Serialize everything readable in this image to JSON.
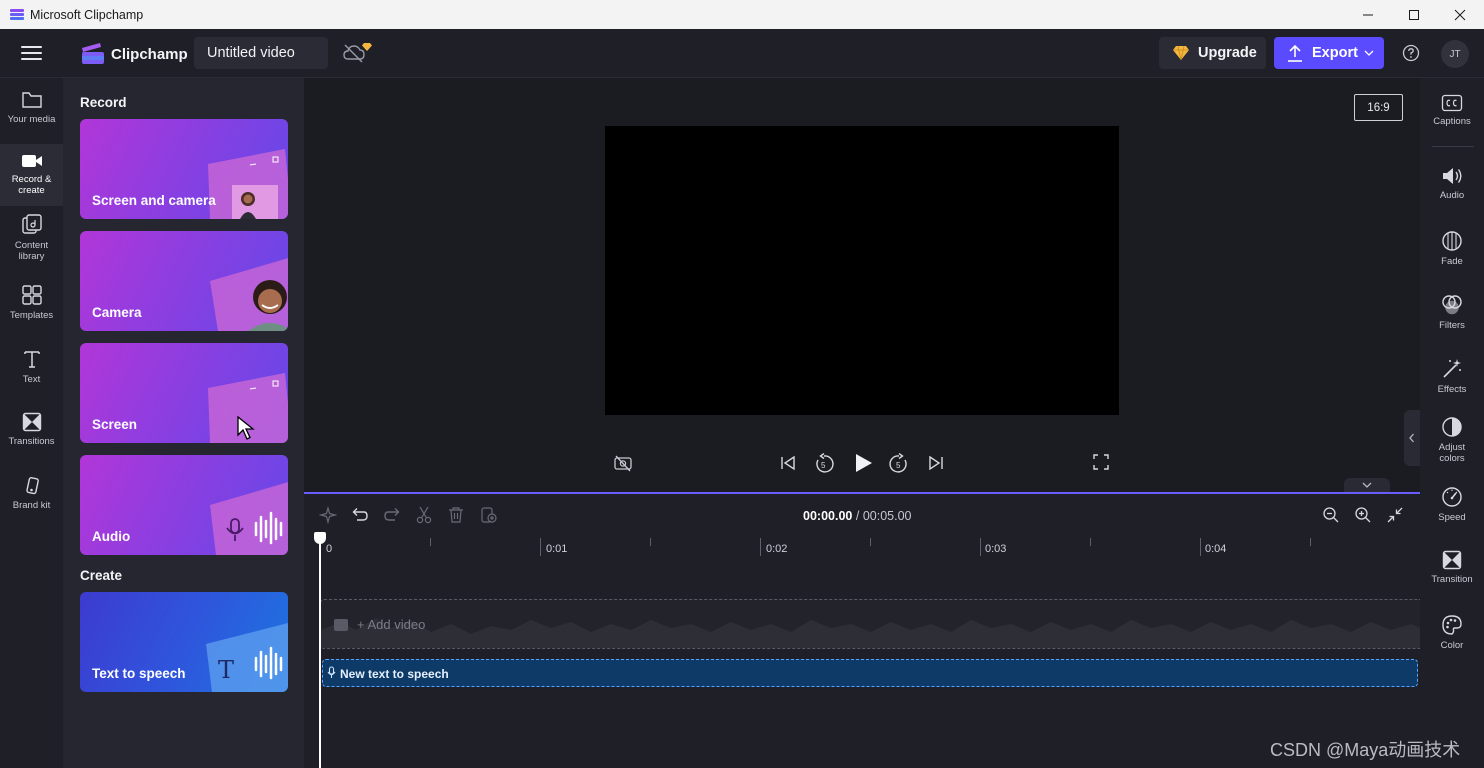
{
  "window": {
    "title": "Microsoft Clipchamp",
    "controls": [
      "minimize-icon",
      "maximize-icon",
      "close-icon"
    ]
  },
  "header": {
    "brand": "Clipchamp",
    "project_title": "Untitled video",
    "upgrade_label": "Upgrade",
    "export_label": "Export",
    "avatar_initials": "JT",
    "icons": [
      "hamburger-menu-icon",
      "clipchamp-logo",
      "cloud-sync-off-icon",
      "premium-gem-icon",
      "export-upload-icon",
      "chevron-down-icon",
      "help-icon"
    ]
  },
  "left_rail": {
    "items": [
      {
        "label": "Your media",
        "icon": "folder-icon"
      },
      {
        "label": "Record & create",
        "icon": "video-camera-icon",
        "active": true
      },
      {
        "label": "Content library",
        "icon": "content-library-icon"
      },
      {
        "label": "Templates",
        "icon": "templates-icon"
      },
      {
        "label": "Text",
        "icon": "text-icon"
      },
      {
        "label": "Transitions",
        "icon": "transitions-icon"
      },
      {
        "label": "Brand kit",
        "icon": "brand-kit-icon"
      }
    ]
  },
  "panel": {
    "record_heading": "Record",
    "record_cards": [
      {
        "label": "Screen and camera"
      },
      {
        "label": "Camera"
      },
      {
        "label": "Screen"
      },
      {
        "label": "Audio"
      }
    ],
    "create_heading": "Create",
    "create_cards": [
      {
        "label": "Text to speech"
      }
    ]
  },
  "preview": {
    "aspect_ratio": "16:9",
    "controls": [
      "camera-off-icon",
      "skip-to-start-icon",
      "rewind-5-icon",
      "play-icon",
      "forward-5-icon",
      "skip-to-end-icon",
      "fullscreen-icon"
    ],
    "rewind_seconds": "5",
    "forward_seconds": "5"
  },
  "timeline": {
    "current_time": "00:00.00",
    "separator": "/",
    "total_time": "00:05.00",
    "ruler_labels": [
      "0",
      "0:01",
      "0:02",
      "0:03",
      "0:04"
    ],
    "add_video_label": "+ Add video",
    "tts_clip_label": "New text to speech",
    "tools": [
      "magic-edit-icon",
      "undo-icon",
      "redo-icon",
      "split-scissors-icon",
      "delete-icon",
      "duplicate-icon",
      "zoom-out-icon",
      "zoom-in-icon",
      "fit-to-screen-icon"
    ]
  },
  "right_rail": {
    "items": [
      {
        "label": "Captions",
        "icon": "captions-icon"
      },
      {
        "label": "Audio",
        "icon": "speaker-icon"
      },
      {
        "label": "Fade",
        "icon": "fade-icon"
      },
      {
        "label": "Filters",
        "icon": "filters-icon"
      },
      {
        "label": "Effects",
        "icon": "effects-wand-icon"
      },
      {
        "label": "Adjust colors",
        "icon": "adjust-colors-icon"
      },
      {
        "label": "Speed",
        "icon": "speed-gauge-icon"
      },
      {
        "label": "Transition",
        "icon": "transition-icon"
      },
      {
        "label": "Color",
        "icon": "color-palette-icon"
      }
    ]
  },
  "watermark": "CSDN @Maya动画技术",
  "colors": {
    "accent": "#5b4bff",
    "timeline_border": "#6a5cff",
    "tts_clip": "#0d3a66",
    "card_gradient_start": "#b236d8",
    "card_gradient_end": "#6448e8",
    "tts_card_start": "#3d3bcf",
    "tts_card_end": "#1d75e0"
  }
}
